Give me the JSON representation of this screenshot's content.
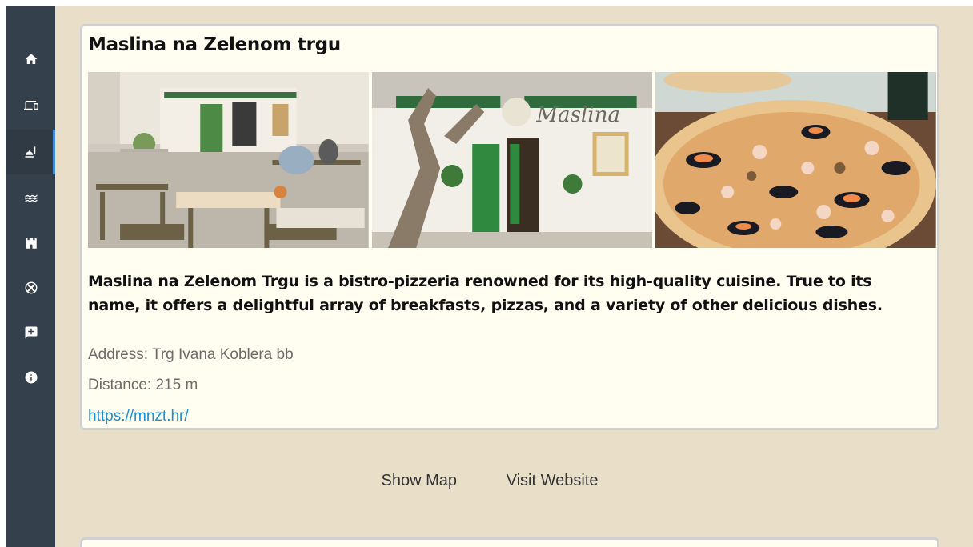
{
  "sidebar": {
    "items": [
      {
        "icon": "home-icon",
        "label": "Home"
      },
      {
        "icon": "devices-icon",
        "label": "Devices"
      },
      {
        "icon": "restaurant-icon",
        "label": "Food & Drink",
        "active": true
      },
      {
        "icon": "waves-icon",
        "label": "Beaches"
      },
      {
        "icon": "castle-icon",
        "label": "Sights"
      },
      {
        "icon": "sports-icon",
        "label": "Sports"
      },
      {
        "icon": "feedback-icon",
        "label": "Feedback"
      },
      {
        "icon": "info-icon",
        "label": "Info"
      }
    ],
    "accent": "#3e8fe0"
  },
  "card": {
    "title": "Maslina na Zelenom trgu",
    "photos": [
      "outdoor-terrace-photo",
      "restaurant-facade-photo",
      "seafood-pizza-photo"
    ],
    "sign_text": "Maslina",
    "description": "Maslina na Zelenom Trgu is a bistro-pizzeria renowned for its high-quality cuisine. True to its name, it offers a delightful array of breakfasts, pizzas, and a variety of other delicious dishes.",
    "address": "Address: Trg Ivana Koblera bb",
    "distance": "Distance: 215 m",
    "url": "https://mnzt.hr/"
  },
  "actions": {
    "show_map": "Show Map",
    "visit_website": "Visit Website"
  },
  "colors": {
    "background": "#e9dfc9",
    "sidebar": "#34404c",
    "card": "#fffef0",
    "link": "#1a8fd6"
  }
}
